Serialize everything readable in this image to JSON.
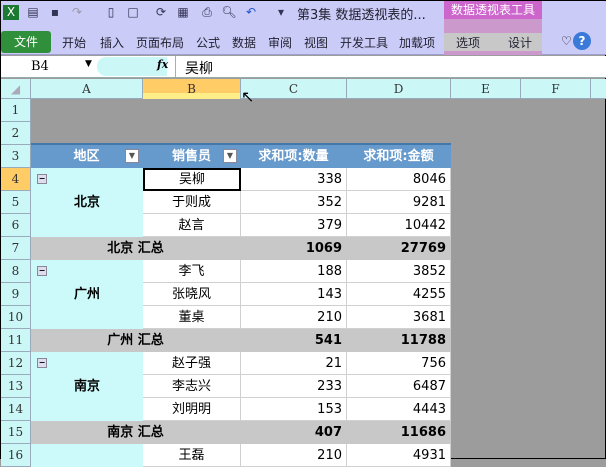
{
  "window": {
    "title": "第3集 数据透视表的...",
    "context_tab_group": "数据透视表工具"
  },
  "ribbon": {
    "file": "文件",
    "tabs": [
      "开始",
      "插入",
      "页面布局",
      "公式",
      "数据",
      "审阅",
      "视图",
      "开发工具",
      "加载项"
    ],
    "context_tabs": [
      "选项",
      "设计"
    ]
  },
  "formula_bar": {
    "name_box": "B4",
    "fx": "fx",
    "value": "吴柳"
  },
  "columns": [
    "A",
    "B",
    "C",
    "D",
    "E",
    "F"
  ],
  "selected_column": "B",
  "rows": [
    "1",
    "2",
    "3",
    "4",
    "5",
    "6",
    "7",
    "8",
    "9",
    "10",
    "11",
    "12",
    "13",
    "14",
    "15",
    "16"
  ],
  "pivot": {
    "headers": [
      "地区",
      "销售员",
      "求和项:数量",
      "求和项:金额"
    ],
    "groups": [
      {
        "region": "北京",
        "items": [
          [
            "吴柳",
            "338",
            "8046"
          ],
          [
            "于则成",
            "352",
            "9281"
          ],
          [
            "赵言",
            "379",
            "10442"
          ]
        ],
        "total_label": "北京 汇总",
        "total": [
          "1069",
          "27769"
        ]
      },
      {
        "region": "广州",
        "items": [
          [
            "李飞",
            "188",
            "3852"
          ],
          [
            "张晓风",
            "143",
            "4255"
          ],
          [
            "董桌",
            "210",
            "3681"
          ]
        ],
        "total_label": "广州 汇总",
        "total": [
          "541",
          "11788"
        ]
      },
      {
        "region": "南京",
        "items": [
          [
            "赵子强",
            "21",
            "756"
          ],
          [
            "李志兴",
            "233",
            "6487"
          ],
          [
            "刘明明",
            "153",
            "4443"
          ]
        ],
        "total_label": "南京 汇总",
        "total": [
          "407",
          "11686"
        ]
      },
      {
        "region": "",
        "items": [
          [
            "王磊",
            "210",
            "4931"
          ]
        ]
      }
    ]
  },
  "colors": {
    "header": "#6699cc",
    "region": "#ccfafa",
    "total": "#c8c8c8",
    "ribbon": "#cbcbf7",
    "context": "#cc66cc"
  }
}
